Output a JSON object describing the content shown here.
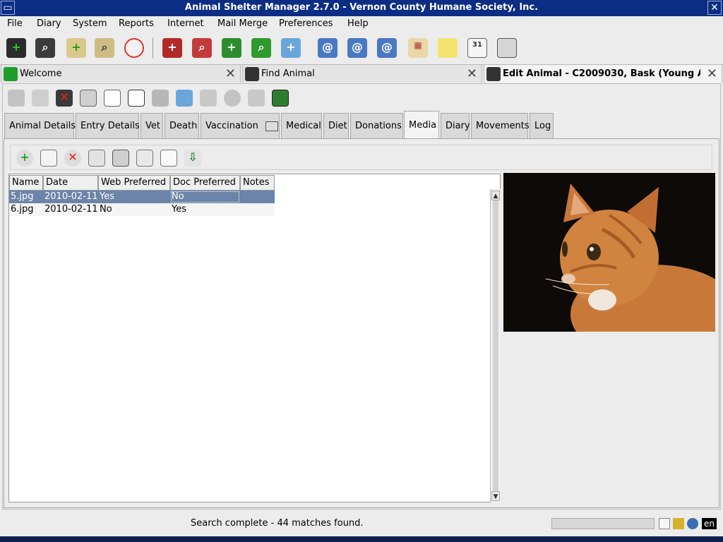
{
  "window": {
    "title": "Animal Shelter Manager 2.7.0 - Vernon County Humane Society, Inc."
  },
  "menu": [
    "File",
    "Diary",
    "System",
    "Reports",
    "Internet",
    "Mail Merge",
    "Preferences",
    "Help"
  ],
  "toolbar_icons": [
    "add-animal-icon",
    "find-animal-icon",
    "add-person-icon",
    "find-person-icon",
    "lost-found-icon",
    "add-lost-animal-icon",
    "find-lost-animal-icon",
    "add-found-animal-icon",
    "find-found-animal-icon",
    "add-waiting-list-icon",
    "email-icon",
    "email-icon",
    "email-icon",
    "diary-icon",
    "note-icon",
    "calendar-icon",
    "print-icon"
  ],
  "doc_tabs": [
    {
      "label": "Welcome",
      "icon": "paw-icon"
    },
    {
      "label": "Find Animal",
      "icon": "cat-icon"
    },
    {
      "label": "Edit Animal - C2009030, Bask (Young A...",
      "icon": "cat-icon"
    }
  ],
  "section_tabs": [
    "Animal Details",
    "Entry Details",
    "Vet",
    "Death",
    "Vaccination",
    "Medical",
    "Diet",
    "Donations",
    "Media",
    "Diary",
    "Movements",
    "Log"
  ],
  "active_section_tab": "Media",
  "media_table": {
    "columns": [
      "Name",
      "Date",
      "Web Preferred",
      "Doc Preferred",
      "Notes"
    ],
    "rows": [
      {
        "name": "5.jpg",
        "date": "2010-02-11",
        "web": "Yes",
        "doc": "No",
        "notes": "",
        "selected": true
      },
      {
        "name": "6.jpg",
        "date": "2010-02-11",
        "web": "No",
        "doc": "Yes",
        "notes": "",
        "selected": false
      }
    ]
  },
  "status": {
    "text": "Search complete - 44 matches found.",
    "language": "en"
  },
  "colors": {
    "titlebar": "#0b2d83",
    "selection": "#6b84a8"
  }
}
